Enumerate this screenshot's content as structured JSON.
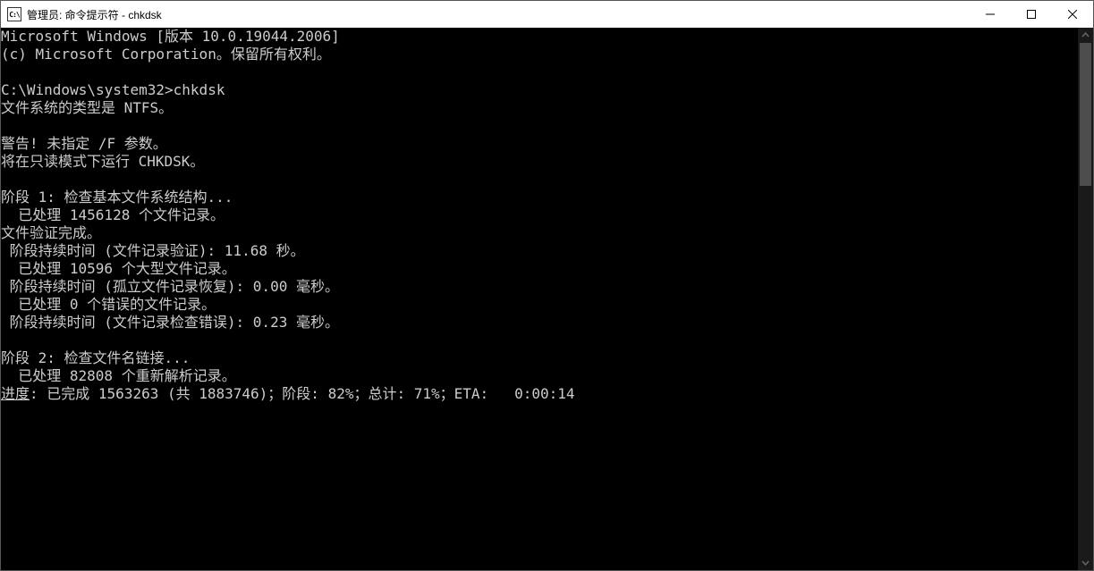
{
  "titlebar": {
    "icon_label": "C:\\",
    "title": "管理员: 命令提示符 - chkdsk"
  },
  "terminal": {
    "lines": [
      "Microsoft Windows [版本 10.0.19044.2006]",
      "(c) Microsoft Corporation。保留所有权利。",
      "",
      "C:\\Windows\\system32>chkdsk",
      "文件系统的类型是 NTFS。",
      "",
      "警告! 未指定 /F 参数。",
      "将在只读模式下运行 CHKDSK。",
      "",
      "阶段 1: 检查基本文件系统结构...",
      "  已处理 1456128 个文件记录。",
      "文件验证完成。",
      " 阶段持续时间 (文件记录验证): 11.68 秒。",
      "  已处理 10596 个大型文件记录。",
      " 阶段持续时间 (孤立文件记录恢复): 0.00 毫秒。",
      "  已处理 0 个错误的文件记录。",
      " 阶段持续时间 (文件记录检查错误): 0.23 毫秒。",
      "",
      "阶段 2: 检查文件名链接...",
      "  已处理 82808 个重新解析记录。"
    ],
    "progress_line_prefix": "进度",
    "progress_line_rest": ": 已完成 1563263 (共 1883746)；阶段: 82%；总计: 71%；ETA:   0:00:14"
  }
}
